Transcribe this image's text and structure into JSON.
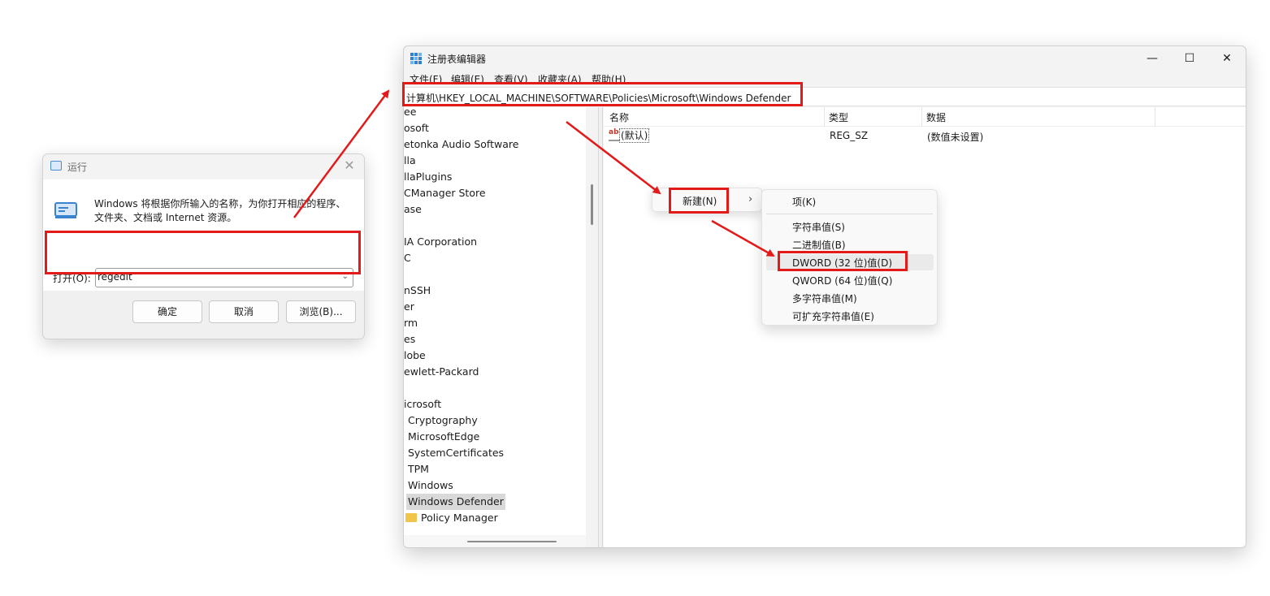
{
  "run_dialog": {
    "title": "运行",
    "description": "Windows 将根据你所输入的名称，为你打开相应的程序、文件夹、文档或 Internet 资源。",
    "open_label": "打开(O):",
    "command_value": "regedit",
    "ok_label": "确定",
    "cancel_label": "取消",
    "browse_label": "浏览(B)..."
  },
  "regedit": {
    "title": "注册表编辑器",
    "menu": [
      "文件(F)",
      "编辑(E)",
      "查看(V)",
      "收藏夹(A)",
      "帮助(H)"
    ],
    "address": "计算机\\HKEY_LOCAL_MACHINE\\SOFTWARE\\Policies\\Microsoft\\Windows Defender",
    "tree_items": [
      "ee",
      "osoft",
      "etonka Audio Software",
      "lla",
      "llaPlugins",
      "CManager Store",
      "ase",
      "",
      "IA Corporation",
      "C",
      "",
      "nSSH",
      "er",
      "rm",
      "es",
      "lobe",
      "ewlett-Packard",
      "",
      "icrosoft"
    ],
    "tree_children": [
      "Cryptography",
      "MicrosoftEdge",
      "SystemCertificates",
      "TPM",
      "Windows",
      "Windows Defender",
      "Policy Manager"
    ],
    "selected_key": "Windows Defender",
    "columns": {
      "name": "名称",
      "type": "类型",
      "data": "数据"
    },
    "values": [
      {
        "name": "(默认)",
        "type": "REG_SZ",
        "data": "(数值未设置)",
        "icon": "ab"
      }
    ]
  },
  "context_menu": {
    "new_label": "新建(N)",
    "submenu": [
      "项(K)",
      "字符串值(S)",
      "二进制值(B)",
      "DWORD (32 位)值(D)",
      "QWORD (64 位)值(Q)",
      "多字符串值(M)",
      "可扩充字符串值(E)"
    ],
    "highlighted": "DWORD (32 位)值(D)"
  },
  "annotation_color": "#e31a1a"
}
